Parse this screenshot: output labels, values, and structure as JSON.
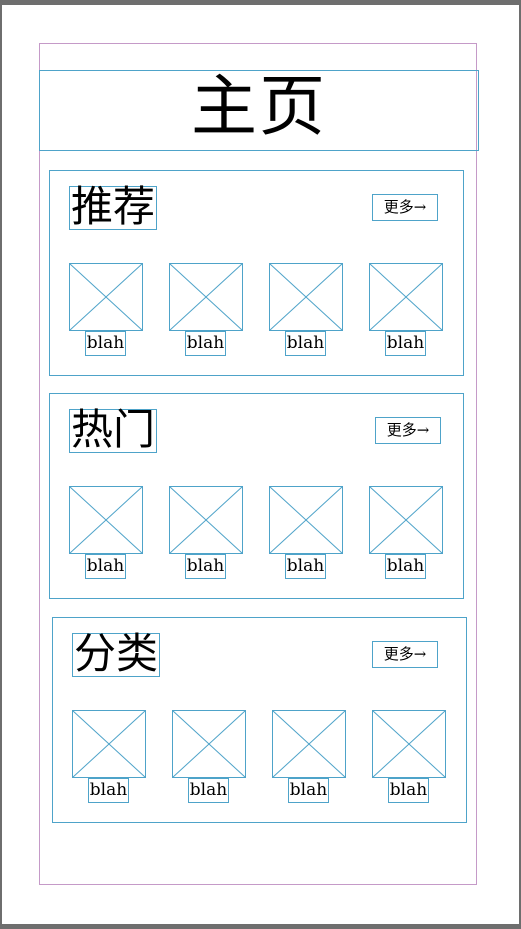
{
  "header": {
    "title": "主页"
  },
  "sections": [
    {
      "title": "推荐",
      "more": "更多→",
      "items": [
        "blah",
        "blah",
        "blah",
        "blah"
      ]
    },
    {
      "title": "热门",
      "more": "更多→",
      "items": [
        "blah",
        "blah",
        "blah",
        "blah"
      ]
    },
    {
      "title": "分类",
      "more": "更多→",
      "items": [
        "blah",
        "blah",
        "blah",
        "blah"
      ]
    }
  ],
  "colors": {
    "wire": "#4ea3c9",
    "frame": "#c59ac8",
    "backdrop": "#6e6e6e"
  }
}
